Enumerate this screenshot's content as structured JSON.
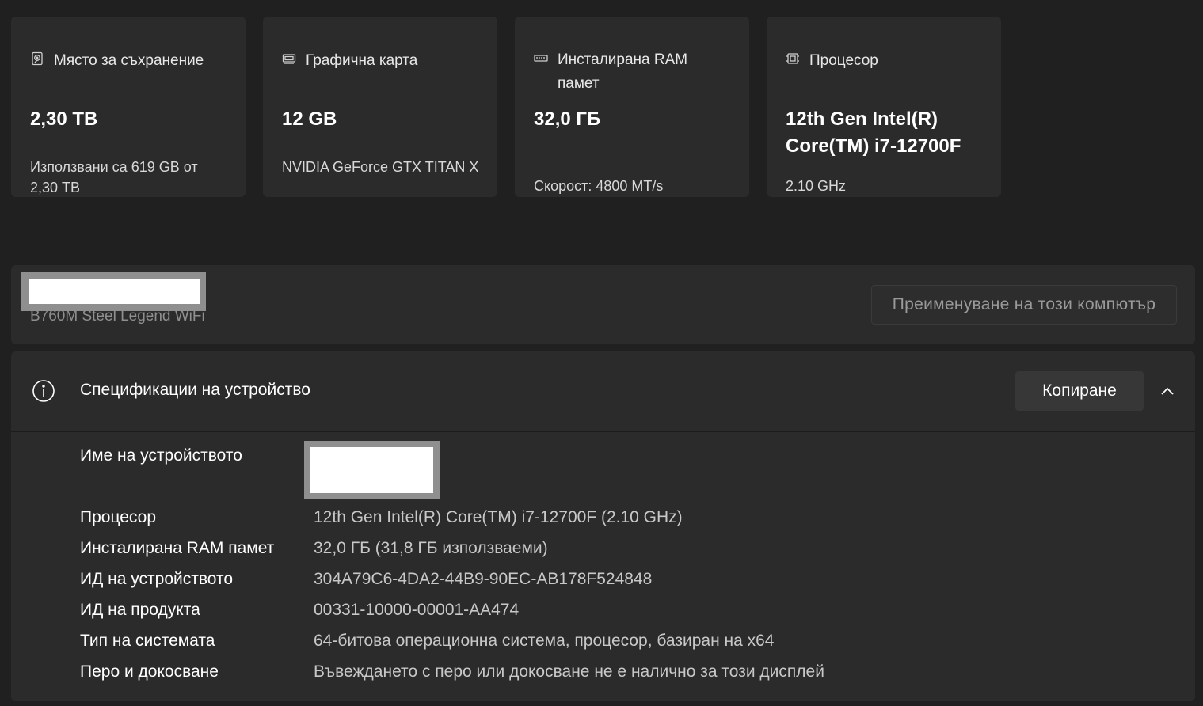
{
  "cards": [
    {
      "icon": "storage-icon",
      "title": "Място за съхранение",
      "value": "2,30 TB",
      "sub": "Използвани са 619 GB от 2,30 TB"
    },
    {
      "icon": "graphics-card-icon",
      "title": "Графична карта",
      "value": "12 GB",
      "sub": "NVIDIA GeForce GTX TITAN X"
    },
    {
      "icon": "ram-icon",
      "title": "Инсталирана RAM памет",
      "value": "32,0 ГБ",
      "sub": "Скорост: 4800 MT/s"
    },
    {
      "icon": "processor-icon",
      "title": "Процесор",
      "value": "12th Gen Intel(R) Core(TM) i7-12700F",
      "sub": "2.10 GHz"
    }
  ],
  "rename": {
    "motherboard": "B760M Steel Legend WiFi",
    "button_label": "Преименуване на този компютър"
  },
  "specs": {
    "title": "Спецификации на устройство",
    "copy_label": "Копиране",
    "rows": [
      {
        "label": "Име на устройството",
        "value": ""
      },
      {
        "label": "Процесор",
        "value": "12th Gen Intel(R) Core(TM) i7-12700F (2.10 GHz)"
      },
      {
        "label": "Инсталирана RAM памет",
        "value": "32,0 ГБ (31,8 ГБ използваеми)"
      },
      {
        "label": "ИД на устройството",
        "value": "304A79C6-4DA2-44B9-90EC-AB178F524848"
      },
      {
        "label": "ИД на продукта",
        "value": "00331-10000-00001-AA474"
      },
      {
        "label": "Тип на системата",
        "value": "64-битова операционна система, процесор, базиран на x64"
      },
      {
        "label": "Перо и докосване",
        "value": "Въвеждането с перо или докосване не е налично за този дисплей"
      }
    ]
  },
  "colors": {
    "background": "#202020",
    "panel": "#2b2b2b",
    "button": "#373737",
    "muted_text": "#8f8f8f"
  }
}
